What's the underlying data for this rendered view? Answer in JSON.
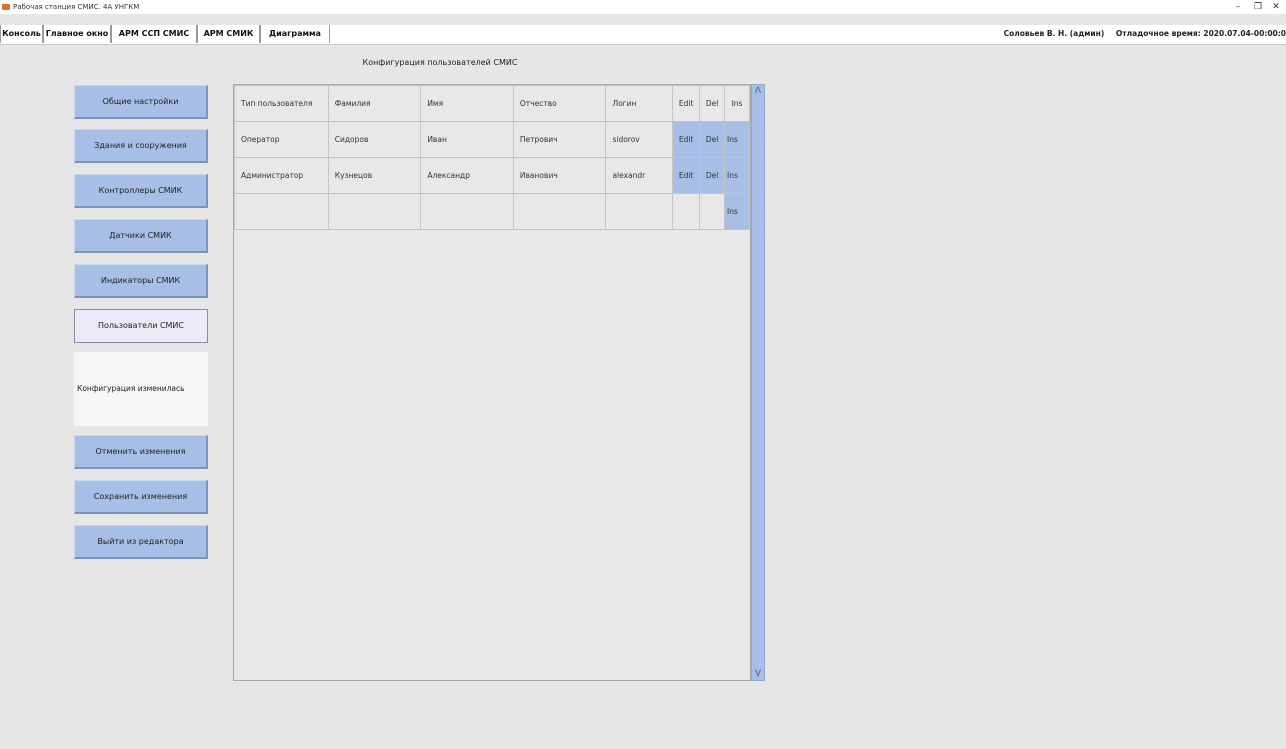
{
  "window": {
    "title": "Рабочая станция СМИС. 4А УНГКМ",
    "minimize": "–",
    "maximize": "❐",
    "close": "✕"
  },
  "tabs": [
    {
      "label": "Консоль"
    },
    {
      "label": "Главное окно"
    },
    {
      "label": "АРМ ССП СМИС"
    },
    {
      "label": "АРМ СМИК"
    },
    {
      "label": "Диаграмма"
    }
  ],
  "status": {
    "user": "Соловьев В. Н. (админ)",
    "debug_time": "Отладочное время: 2020.07.04-00:00:0"
  },
  "page_title": "Конфигурация пользователей СМИС",
  "sidebar": {
    "items": [
      {
        "label": "Общие настройки"
      },
      {
        "label": "Здания и сооружения"
      },
      {
        "label": "Контроллеры СМИК"
      },
      {
        "label": "Датчики СМИК"
      },
      {
        "label": "Индикаторы СМИК"
      },
      {
        "label": "Пользователи СМИС"
      }
    ],
    "status_message": "Конфигурация изменилась",
    "actions": [
      {
        "label": "Отменить изменения"
      },
      {
        "label": "Сохранить изменения"
      },
      {
        "label": "Выйти из редактора"
      }
    ]
  },
  "table": {
    "headers": [
      "Тип пользователя",
      "Фамилия",
      "Имя",
      "Отчество",
      "Логин",
      "Edit",
      "Del",
      "Ins"
    ],
    "rows": [
      {
        "type": "Оператор",
        "last": "Сидоров",
        "first": "Иван",
        "middle": "Петрович",
        "login": "sidorov",
        "edit": "Edit",
        "del": "Del",
        "ins": "Ins"
      },
      {
        "type": "Администратор",
        "last": "Кузнецов",
        "first": "Александр",
        "middle": "Иванович",
        "login": "alexandr",
        "edit": "Edit",
        "del": "Del",
        "ins": "Ins"
      },
      {
        "type": "",
        "last": "",
        "first": "",
        "middle": "",
        "login": "",
        "edit": "",
        "del": "",
        "ins": "Ins"
      }
    ]
  },
  "scrollbar": {
    "up": "Λ",
    "down": "V"
  },
  "colors": {
    "accent": "#a7bfe6",
    "background": "#e6e6e6"
  }
}
